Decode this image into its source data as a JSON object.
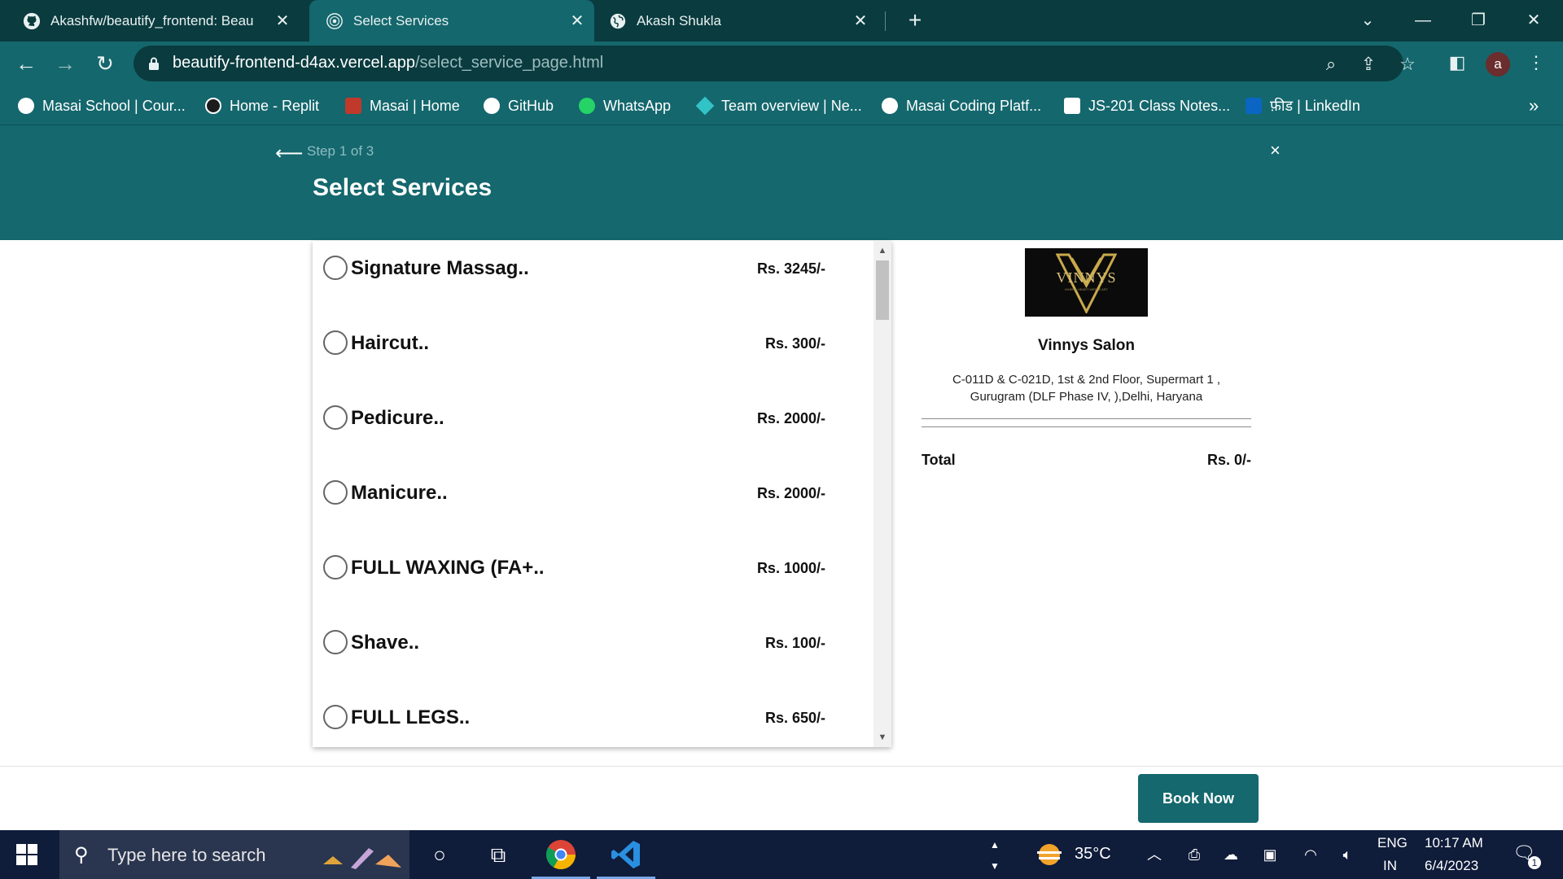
{
  "browser": {
    "tabs": [
      {
        "title": "Akashfw/beautify_frontend: Beau",
        "icon": "github-icon"
      },
      {
        "title": "Select Services",
        "icon": "vercel-globe-icon"
      },
      {
        "title": "Akash Shukla",
        "icon": "globe-icon"
      }
    ],
    "url_host": "beautify-frontend-d4ax.vercel.app",
    "url_path": "/select_service_page.html",
    "profile_initial": "a",
    "bookmarks": [
      {
        "label": "Masai School | Cour...",
        "icon": "masai-icon"
      },
      {
        "label": "Home - Replit",
        "icon": "replit-icon"
      },
      {
        "label": "Masai | Home",
        "icon": "masai-flag-icon"
      },
      {
        "label": "GitHub",
        "icon": "github-icon"
      },
      {
        "label": "WhatsApp",
        "icon": "whatsapp-icon"
      },
      {
        "label": "Team overview | Ne...",
        "icon": "netlify-icon"
      },
      {
        "label": "Masai Coding Platf...",
        "icon": "masai-m-icon"
      },
      {
        "label": "JS-201 Class Notes...",
        "icon": "notion-icon"
      },
      {
        "label": "फ़ीड | LinkedIn",
        "icon": "linkedin-icon"
      }
    ],
    "bookmarks_overflow": "»"
  },
  "header": {
    "back_symbol": "⟵",
    "step_text": "Step 1 of 3",
    "title": "Select Services",
    "close_symbol": "×"
  },
  "services": [
    {
      "name": "Signature Massag..",
      "price": "Rs. 3245/-"
    },
    {
      "name": "Haircut..",
      "price": "Rs. 300/-"
    },
    {
      "name": "Pedicure..",
      "price": "Rs. 2000/-"
    },
    {
      "name": "Manicure..",
      "price": "Rs. 2000/-"
    },
    {
      "name": "FULL WAXING (FA+..",
      "price": "Rs. 1000/-"
    },
    {
      "name": "Shave..",
      "price": "Rs. 100/-"
    },
    {
      "name": "FULL LEGS..",
      "price": "Rs. 650/-"
    }
  ],
  "salon": {
    "logo_text": "VINNYS",
    "logo_tagline": "WHERE HEART MEETS ART",
    "name": "Vinnys Salon",
    "address_line1": "C-011D & C-021D, 1st & 2nd Floor, Supermart 1 ,",
    "address_line2": "Gurugram (DLF Phase IV, ),Delhi, Haryana",
    "total_label": "Total",
    "total_value": "Rs. 0/-"
  },
  "footer": {
    "book_label": "Book Now"
  },
  "taskbar": {
    "search_placeholder": "Type here to search",
    "weather": "35°C",
    "lang_line1": "ENG",
    "lang_line2": "IN",
    "time": "10:17 AM",
    "date": "6/4/2023",
    "notifications": "1"
  },
  "colors": {
    "brand_teal": "#14686e",
    "tab_bar": "#0a3b3f",
    "taskbar": "#0f1c3a"
  }
}
